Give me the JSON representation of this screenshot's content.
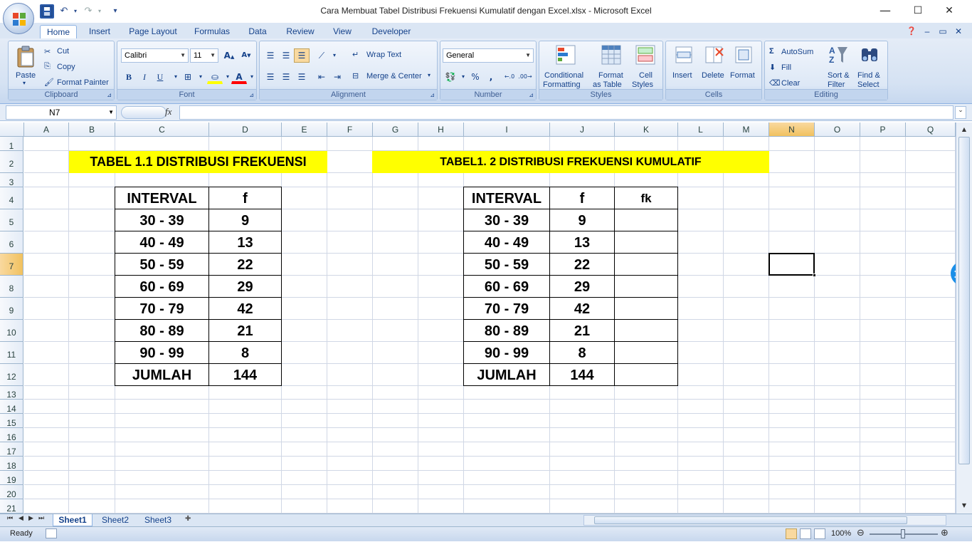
{
  "window": {
    "title": "Cara Membuat Tabel Distribusi Frekuensi Kumulatif dengan Excel.xlsx - Microsoft Excel",
    "minimize": "—",
    "maximize": "☐",
    "close": "✕"
  },
  "quick_access": {
    "customize": "▾"
  },
  "ribbon_tabs": [
    "Home",
    "Insert",
    "Page Layout",
    "Formulas",
    "Data",
    "Review",
    "View",
    "Developer"
  ],
  "clipboard": {
    "paste": "Paste",
    "cut": "Cut",
    "copy": "Copy",
    "format_painter": "Format Painter",
    "label": "Clipboard"
  },
  "font": {
    "name": "Calibri",
    "size": "11",
    "label": "Font",
    "bold": "B",
    "italic": "I",
    "underline": "U"
  },
  "alignment": {
    "wrap": "Wrap Text",
    "merge": "Merge & Center",
    "label": "Alignment"
  },
  "number": {
    "format": "General",
    "label": "Number",
    "percent": "%",
    "comma": ","
  },
  "styles": {
    "conditional": "Conditional",
    "conditional2": "Formatting",
    "format_table": "Format",
    "format_table2": "as Table",
    "cell_styles": "Cell",
    "cell_styles2": "Styles",
    "label": "Styles"
  },
  "cells": {
    "insert": "Insert",
    "delete": "Delete",
    "format": "Format",
    "label": "Cells"
  },
  "editing": {
    "autosum": "AutoSum",
    "fill": "Fill",
    "clear": "Clear",
    "sort": "Sort &",
    "sort2": "Filter",
    "find": "Find &",
    "find2": "Select",
    "label": "Editing"
  },
  "formula_bar": {
    "name_box": "N7",
    "fx": "fx",
    "value": ""
  },
  "columns": [
    "A",
    "B",
    "C",
    "D",
    "E",
    "F",
    "G",
    "H",
    "I",
    "J",
    "K",
    "L",
    "M",
    "N",
    "O",
    "P",
    "Q"
  ],
  "rows": [
    "1",
    "2",
    "3",
    "4",
    "5",
    "6",
    "7",
    "8",
    "9",
    "10",
    "11",
    "12",
    "13",
    "14",
    "15",
    "16",
    "17",
    "18",
    "19",
    "20",
    "21"
  ],
  "table1": {
    "title": "TABEL 1.1 DISTRIBUSI FREKUENSI",
    "headers": [
      "INTERVAL",
      "f"
    ],
    "rows": [
      [
        "30 - 39",
        "9"
      ],
      [
        "40 - 49",
        "13"
      ],
      [
        "50 - 59",
        "22"
      ],
      [
        "60 - 69",
        "29"
      ],
      [
        "70 - 79",
        "42"
      ],
      [
        "80 - 89",
        "21"
      ],
      [
        "90 - 99",
        "8"
      ],
      [
        "JUMLAH",
        "144"
      ]
    ]
  },
  "table2": {
    "title": "TABEL1. 2 DISTRIBUSI FREKUENSI KUMULATIF",
    "headers": [
      "INTERVAL",
      "f",
      "fk"
    ],
    "rows": [
      [
        "30 - 39",
        "9",
        ""
      ],
      [
        "40 - 49",
        "13",
        ""
      ],
      [
        "50 - 59",
        "22",
        ""
      ],
      [
        "60 - 69",
        "29",
        ""
      ],
      [
        "70 - 79",
        "42",
        ""
      ],
      [
        "80 - 89",
        "21",
        ""
      ],
      [
        "90 - 99",
        "8",
        ""
      ],
      [
        "JUMLAH",
        "144",
        ""
      ]
    ]
  },
  "sheets": [
    "Sheet1",
    "Sheet2",
    "Sheet3"
  ],
  "status": {
    "ready": "Ready",
    "zoom": "100%"
  },
  "colors": {
    "title_fill": "#ffff00",
    "selected_header": "#f1c15f",
    "ribbon": "#dbe6f4"
  }
}
